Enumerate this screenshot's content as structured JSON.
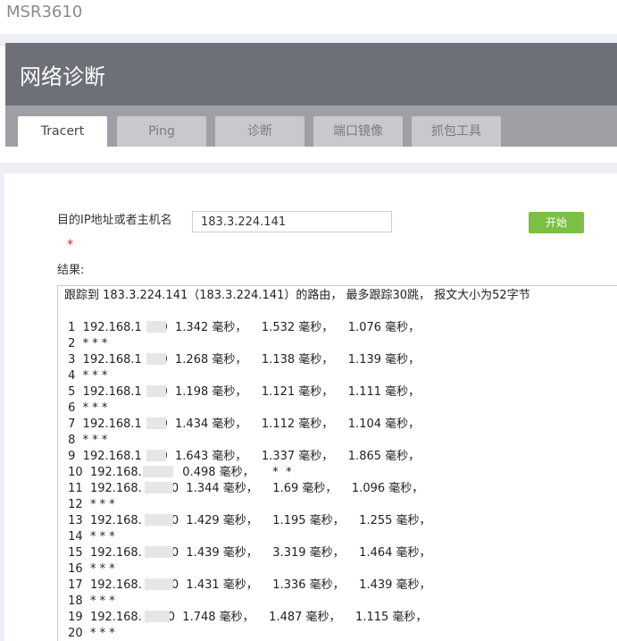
{
  "brand": "MSR3610",
  "page_title": "网络诊断",
  "tabs": [
    {
      "label": "Tracert",
      "active": true
    },
    {
      "label": "Ping",
      "active": false
    },
    {
      "label": "诊断",
      "active": false
    },
    {
      "label": "端口镜像",
      "active": false
    },
    {
      "label": "抓包工具",
      "active": false
    }
  ],
  "form": {
    "target_label": "目的IP地址或者主机名",
    "target_value": "183.3.224.141",
    "required_mark": "*",
    "start_button": "开始",
    "result_label": "结果:"
  },
  "result_lines": [
    "跟踪到 183.3.224.141（183.3.224.141）的路由， 最多跟踪30跳， 报文大小为52字节",
    "",
    " 1  192.168.1  .20  1.342 毫秒，    1.532 毫秒，    1.076 毫秒，",
    " 2  * * *",
    " 3  192.168.1  .20  1.268 毫秒，    1.138 毫秒，    1.139 毫秒，",
    " 4  * * *",
    " 5  192.168.1  .20  1.198 毫秒，    1.121 毫秒，    1.111 毫秒，",
    " 6  * * *",
    " 7  192.168.1  .20  1.434 毫秒，    1.112 毫秒，    1.104 毫秒，",
    " 8  * * *",
    " 9  192.168.1  .20  1.643 毫秒，    1.337 毫秒，    1.865 毫秒，",
    " 10  192.168.   .31   0.498 毫秒，     *  *",
    " 11  192.168.     .20  1.344 毫秒，    1.69 毫秒，    1.096 毫秒，",
    " 12  * * *",
    " 13  192.168.     .20  1.429 毫秒，    1.195 毫秒，    1.255 毫秒，",
    " 14  * * *",
    " 15  192.168.     .20  1.439 毫秒，    3.319 毫秒，    1.464 毫秒，",
    " 16  * * *",
    " 17  192.168.     .20  1.431 毫秒，    1.336 毫秒，    1.439 毫秒，",
    " 18  * * *",
    " 19  192.168.    .20  1.748 毫秒，    1.487 毫秒，    1.115 毫秒，",
    " 20  * * *"
  ]
}
